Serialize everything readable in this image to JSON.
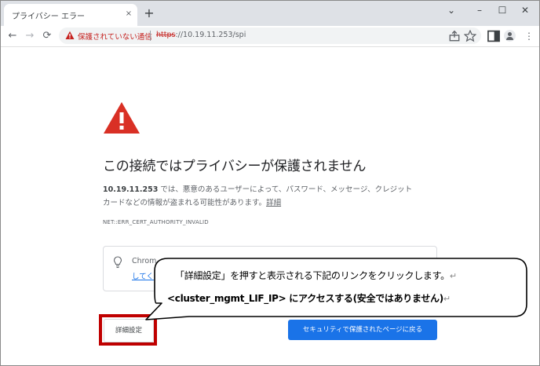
{
  "tab": {
    "title": "プライバシー エラー",
    "close": "×",
    "new_tab": "+"
  },
  "window": {
    "chevron": "⌄",
    "minimize": "–",
    "maximize": "☐",
    "close": "✕"
  },
  "toolbar": {
    "back": "←",
    "forward": "→",
    "reload": "⟳",
    "security_label": "保護されていない通信",
    "url_scheme": "https",
    "url_rest": "://10.19.11.253/spi",
    "menu": "⋮"
  },
  "page": {
    "heading": "この接続ではプライバシーが保護されません",
    "host": "10.19.11.253",
    "desc_line1": " では、悪意のあるユーザーによって、パスワード、メッセージ、クレジット",
    "desc_line2": "カードなどの情報が盗まれる可能性があります。",
    "desc_link": "詳細",
    "error_code": "NET::ERR_CERT_AUTHORITY_INVALID",
    "info_text": "Chrom",
    "info_link": "してく",
    "details_button": "詳細設定",
    "back_button": "セキュリティで保護されたページに戻る"
  },
  "callout": {
    "line1": "「詳細設定」を押すと表示される下記のリンクをクリックします。",
    "line2_bold": "<cluster_mgmt_LIF_IP>",
    "line2_rest": " にアクセスする(安全ではありません)",
    "return_mark": "↵"
  },
  "colors": {
    "error_red": "#d93025",
    "highlight": "#c00000",
    "button_blue": "#1a73e8",
    "not_secure": "#c5221f"
  },
  "icons": [
    "warning-icon",
    "error-triangle-icon",
    "lightbulb-icon",
    "share-icon",
    "star-icon",
    "side-panel-icon",
    "avatar"
  ]
}
